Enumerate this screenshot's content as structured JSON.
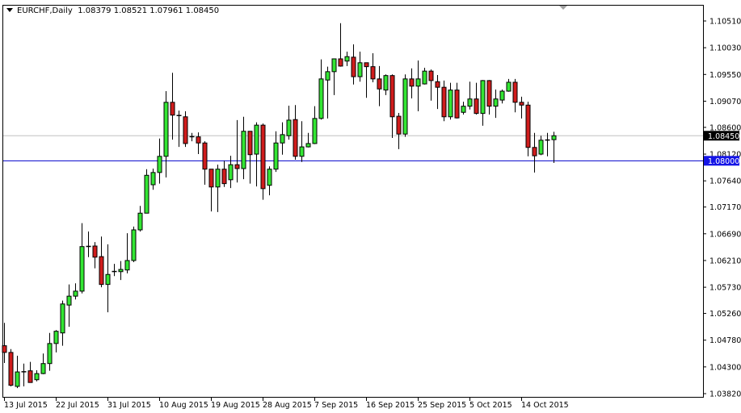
{
  "header": {
    "symbol_timeframe": "EURCHF,Daily",
    "ohlc": "1.08379 1.08521 1.07961 1.08450"
  },
  "colors": {
    "bull": "#33e633",
    "bear": "#d01c1c",
    "outline": "#000000",
    "level_line": "#0000cc",
    "price_line": "#c0c0c0"
  },
  "chart_data": {
    "type": "candlestick",
    "title": "EURCHF,Daily",
    "ylim": [
      1.0382,
      1.1051
    ],
    "y_ticks": [
      "1.10510",
      "1.10030",
      "1.09550",
      "1.09070",
      "1.08600",
      "1.08120",
      "1.07640",
      "1.07170",
      "1.06690",
      "1.06210",
      "1.05730",
      "1.05260",
      "1.04780",
      "1.04300",
      "1.03820"
    ],
    "x_ticks": [
      {
        "bar": 0,
        "label": "13 Jul 2015"
      },
      {
        "bar": 8,
        "label": "22 Jul 2015"
      },
      {
        "bar": 16,
        "label": "31 Jul 2015"
      },
      {
        "bar": 24,
        "label": "10 Aug 2015"
      },
      {
        "bar": 32,
        "label": "19 Aug 2015"
      },
      {
        "bar": 40,
        "label": "28 Aug 2015"
      },
      {
        "bar": 48,
        "label": "7 Sep 2015"
      },
      {
        "bar": 56,
        "label": "16 Sep 2015"
      },
      {
        "bar": 64,
        "label": "25 Sep 2015"
      },
      {
        "bar": 72,
        "label": "5 Oct 2015"
      },
      {
        "bar": 80,
        "label": "14 Oct 2015"
      }
    ],
    "current_price": {
      "value": 1.0845,
      "label": "1.08450"
    },
    "horizontal_level": {
      "value": 1.08,
      "label": "1.08000"
    },
    "ohlc_fields": [
      "open",
      "high",
      "low",
      "close"
    ],
    "candles": [
      [
        1.0468,
        1.0509,
        1.0437,
        1.0456
      ],
      [
        1.0456,
        1.0462,
        1.0395,
        1.0397
      ],
      [
        1.0395,
        1.045,
        1.0392,
        1.0421
      ],
      [
        1.0421,
        1.0436,
        1.0395,
        1.0422
      ],
      [
        1.0423,
        1.0439,
        1.0402,
        1.0402
      ],
      [
        1.0407,
        1.0424,
        1.0404,
        1.0418
      ],
      [
        1.0418,
        1.0454,
        1.0417,
        1.0436
      ],
      [
        1.0436,
        1.0491,
        1.0423,
        1.0472
      ],
      [
        1.0472,
        1.0496,
        1.0456,
        1.0494
      ],
      [
        1.0491,
        1.0549,
        1.0468,
        1.0543
      ],
      [
        1.0541,
        1.0578,
        1.0502,
        1.0557
      ],
      [
        1.0557,
        1.058,
        1.0551,
        1.0566
      ],
      [
        1.0566,
        1.0688,
        1.0562,
        1.0646
      ],
      [
        1.0646,
        1.0673,
        1.0627,
        1.0647
      ],
      [
        1.0647,
        1.0654,
        1.0607,
        1.0627
      ],
      [
        1.0628,
        1.0664,
        1.0573,
        1.0578
      ],
      [
        1.0578,
        1.065,
        1.0528,
        1.0596
      ],
      [
        1.0602,
        1.0615,
        1.0593,
        1.0601
      ],
      [
        1.0601,
        1.062,
        1.0586,
        1.0605
      ],
      [
        1.0604,
        1.067,
        1.0598,
        1.0621
      ],
      [
        1.0621,
        1.0682,
        1.0618,
        1.0676
      ],
      [
        1.0676,
        1.0719,
        1.0673,
        1.0706
      ],
      [
        1.0706,
        1.0785,
        1.0706,
        1.0774
      ],
      [
        1.0757,
        1.0786,
        1.0748,
        1.0779
      ],
      [
        1.0779,
        1.084,
        1.0759,
        1.0808
      ],
      [
        1.0808,
        1.0925,
        1.077,
        1.0905
      ],
      [
        1.0905,
        1.0958,
        1.0838,
        1.0882
      ],
      [
        1.0882,
        1.089,
        1.0825,
        1.0881
      ],
      [
        1.0879,
        1.0889,
        1.0825,
        1.0831
      ],
      [
        1.0844,
        1.085,
        1.0835,
        1.0843
      ],
      [
        1.0843,
        1.0851,
        1.0812,
        1.0832
      ],
      [
        1.0832,
        1.0835,
        1.0757,
        1.0785
      ],
      [
        1.0785,
        1.0785,
        1.0709,
        1.0753
      ],
      [
        1.0753,
        1.0793,
        1.0708,
        1.0785
      ],
      [
        1.0785,
        1.08,
        1.0753,
        1.0759
      ],
      [
        1.0766,
        1.0809,
        1.0751,
        1.0793
      ],
      [
        1.0793,
        1.0873,
        1.0761,
        1.0786
      ],
      [
        1.0786,
        1.0879,
        1.0767,
        1.0853
      ],
      [
        1.0853,
        1.0853,
        1.0759,
        1.0811
      ],
      [
        1.0812,
        1.0869,
        1.0754,
        1.0864
      ],
      [
        1.0864,
        1.0867,
        1.073,
        1.075
      ],
      [
        1.0756,
        1.079,
        1.0738,
        1.0785
      ],
      [
        1.0785,
        1.0853,
        1.078,
        1.0832
      ],
      [
        1.0832,
        1.0869,
        1.0811,
        1.0847
      ],
      [
        1.0845,
        1.0899,
        1.0838,
        1.0873
      ],
      [
        1.0874,
        1.09,
        1.0802,
        1.0808
      ],
      [
        1.0808,
        1.0871,
        1.0798,
        1.0825
      ],
      [
        1.0825,
        1.085,
        1.0824,
        1.0831
      ],
      [
        1.0831,
        1.0898,
        1.083,
        1.0876
      ],
      [
        1.0876,
        1.0982,
        1.0874,
        1.0947
      ],
      [
        1.0945,
        1.0969,
        1.0876,
        1.096
      ],
      [
        1.096,
        1.0983,
        1.0918,
        1.0983
      ],
      [
        1.0983,
        1.1047,
        1.0969,
        1.097
      ],
      [
        1.0979,
        1.0996,
        1.097,
        1.0987
      ],
      [
        1.0986,
        1.1009,
        1.0937,
        1.0951
      ],
      [
        1.0951,
        1.0996,
        1.0942,
        1.0976
      ],
      [
        1.0976,
        1.0976,
        1.0913,
        1.0969
      ],
      [
        1.0969,
        1.0993,
        1.0941,
        1.0947
      ],
      [
        1.0947,
        1.097,
        1.0898,
        1.0929
      ],
      [
        1.0927,
        1.0955,
        1.0918,
        1.0953
      ],
      [
        1.0953,
        1.0955,
        1.0841,
        1.0879
      ],
      [
        1.088,
        1.0886,
        1.0821,
        1.0848
      ],
      [
        1.0848,
        1.0955,
        1.0843,
        1.0947
      ],
      [
        1.0947,
        1.0966,
        1.0912,
        1.0934
      ],
      [
        1.0934,
        1.098,
        1.0889,
        1.0947
      ],
      [
        1.0938,
        1.0967,
        1.0937,
        1.0961
      ],
      [
        1.0961,
        1.0964,
        1.0908,
        1.0944
      ],
      [
        1.0942,
        1.0954,
        1.0893,
        1.0932
      ],
      [
        1.0932,
        1.0944,
        1.0871,
        1.0879
      ],
      [
        1.0879,
        1.094,
        1.0874,
        1.0927
      ],
      [
        1.0927,
        1.094,
        1.0876,
        1.0877
      ],
      [
        1.0887,
        1.0906,
        1.0883,
        1.0898
      ],
      [
        1.0898,
        1.0942,
        1.0892,
        1.0911
      ],
      [
        1.0911,
        1.094,
        1.0883,
        1.0885
      ],
      [
        1.0885,
        1.0945,
        1.0863,
        1.0944
      ],
      [
        1.0944,
        1.0945,
        1.0883,
        1.0898
      ],
      [
        1.0898,
        1.0928,
        1.0877,
        1.0911
      ],
      [
        1.0909,
        1.0928,
        1.0903,
        1.0925
      ],
      [
        1.0925,
        1.0947,
        1.0924,
        1.0941
      ],
      [
        1.0941,
        1.0947,
        1.0887,
        1.0905
      ],
      [
        1.0905,
        1.0915,
        1.0876,
        1.09
      ],
      [
        1.09,
        1.0906,
        1.0808,
        1.0824
      ],
      [
        1.0824,
        1.085,
        1.0779,
        1.0809
      ],
      [
        1.0812,
        1.0845,
        1.081,
        1.0837
      ],
      [
        1.0837,
        1.085,
        1.0808,
        1.0838
      ],
      [
        1.08379,
        1.08521,
        1.07961,
        1.0845
      ]
    ]
  }
}
